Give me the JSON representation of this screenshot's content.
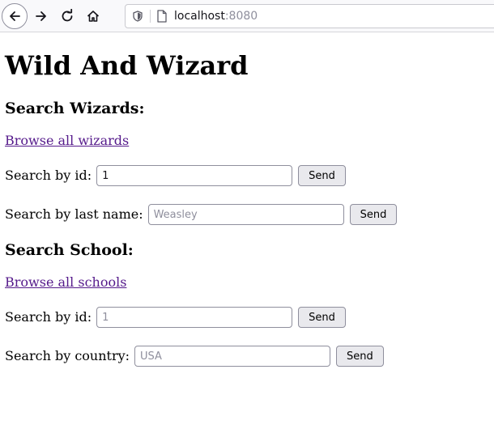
{
  "browser": {
    "url_host": "localhost",
    "url_port": ":8080"
  },
  "page": {
    "title": "Wild And Wizard"
  },
  "wizards": {
    "heading": "Search Wizards:",
    "browse_link": "Browse all wizards",
    "by_id": {
      "label": "Search by id:",
      "value": "1",
      "placeholder": "",
      "button": "Send"
    },
    "by_last_name": {
      "label": "Search by last name:",
      "value": "",
      "placeholder": "Weasley",
      "button": "Send"
    }
  },
  "school": {
    "heading": "Search School:",
    "browse_link": "Browse all schools",
    "by_id": {
      "label": "Search by id:",
      "value": "",
      "placeholder": "1",
      "button": "Send"
    },
    "by_country": {
      "label": "Search by country:",
      "value": "",
      "placeholder": "USA",
      "button": "Send"
    }
  }
}
